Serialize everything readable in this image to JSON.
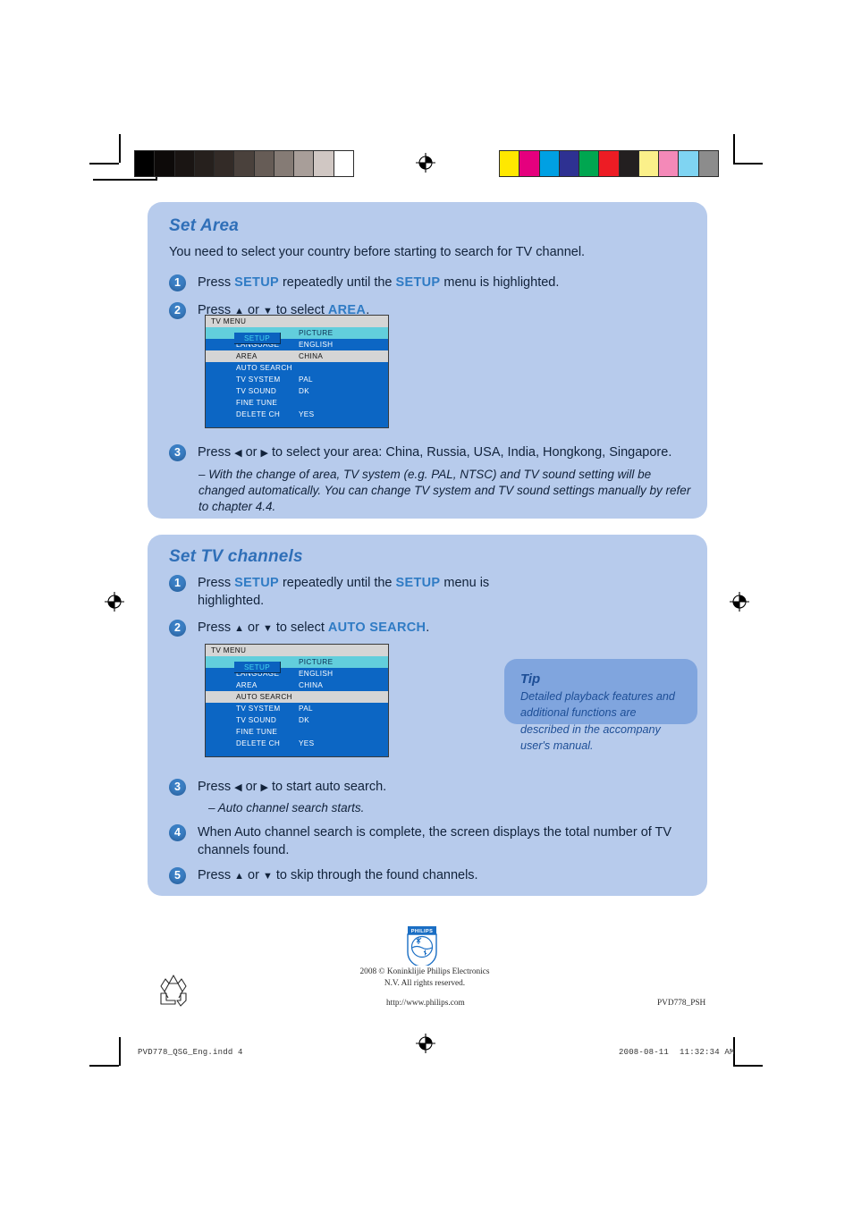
{
  "document": {
    "language": "English"
  },
  "colorbars": {
    "grayscale_label": "grayscale-calibration-bar",
    "grayscale": [
      "#000000",
      "#0d0a09",
      "#1a1513",
      "#26201d",
      "#332b27",
      "#4a413c",
      "#665c56",
      "#857b75",
      "#a89e99",
      "#d0c7c3",
      "#ffffff"
    ],
    "process_label": "process-color-calibration-bar",
    "process": [
      "#ffe800",
      "#e5007e",
      "#00a0e3",
      "#2e3192",
      "#00a650",
      "#ed1c24",
      "#231f20",
      "#fbf08a",
      "#f489b8",
      "#7fd4f2",
      "#8c8c8c"
    ]
  },
  "sections": [
    {
      "id": "set-area",
      "title": "Set Area",
      "intro": "You need to select your country before starting to search for TV channel.",
      "steps": [
        {
          "number": "1",
          "parts": [
            {
              "t": "Press ",
              "k": false
            },
            {
              "t": "SETUP",
              "k": true
            },
            {
              "t": " repeatedly until the ",
              "k": false
            },
            {
              "t": "SETUP",
              "k": true
            },
            {
              "t": " menu is highlighted.",
              "k": false
            }
          ]
        },
        {
          "number": "2",
          "parts": [
            {
              "t": "Press ",
              "k": false
            },
            {
              "t": "▲",
              "k": false
            },
            {
              "t": " or ",
              "k": false
            },
            {
              "t": "▼",
              "k": false
            },
            {
              "t": " to select ",
              "k": false
            },
            {
              "t": "AREA",
              "k": true
            },
            {
              "t": ".",
              "k": false
            }
          ]
        },
        {
          "number": "3",
          "parts": [
            {
              "t": "Press ",
              "k": false
            },
            {
              "t": "◀",
              "k": false
            },
            {
              "t": " or ",
              "k": false
            },
            {
              "t": "▶",
              "k": false
            },
            {
              "t": " to select your area: China, Russia, USA, India, Hongkong, Singapore.",
              "k": false
            }
          ],
          "note": "– With the change of area, TV system (e.g. PAL, NTSC) and TV sound setting will be changed automatically. You can change TV system and TV sound settings manually by refer to chapter 4.4."
        }
      ]
    },
    {
      "id": "set-tv-channels",
      "title": "Set TV channels",
      "steps": [
        {
          "number": "1",
          "parts": [
            {
              "t": "Press ",
              "k": false
            },
            {
              "t": "SETUP",
              "k": true
            },
            {
              "t": " repeatedly until the ",
              "k": false
            },
            {
              "t": "SETUP",
              "k": true
            },
            {
              "t": " menu is highlighted.",
              "k": false
            }
          ]
        },
        {
          "number": "2",
          "parts": [
            {
              "t": "Press ",
              "k": false
            },
            {
              "t": "▲",
              "k": false
            },
            {
              "t": " or ",
              "k": false
            },
            {
              "t": "▼",
              "k": false
            },
            {
              "t": " to select ",
              "k": false
            },
            {
              "t": "AUTO SEARCH",
              "k": true
            },
            {
              "t": ".",
              "k": false
            }
          ]
        },
        {
          "number": "3",
          "parts": [
            {
              "t": "Press ",
              "k": false
            },
            {
              "t": "◀",
              "k": false
            },
            {
              "t": " or ",
              "k": false
            },
            {
              "t": "▶",
              "k": false
            },
            {
              "t": " to start auto search.",
              "k": false
            }
          ],
          "note": "– Auto channel search starts."
        },
        {
          "number": "4",
          "parts": [
            {
              "t": "When Auto channel search is complete, the screen displays the total number of TV channels found.",
              "k": false
            }
          ]
        },
        {
          "number": "5",
          "parts": [
            {
              "t": "Press ",
              "k": false
            },
            {
              "t": "▲",
              "k": false
            },
            {
              "t": " or ",
              "k": false
            },
            {
              "t": "▼",
              "k": false
            },
            {
              "t": " to skip through the found channels.",
              "k": false
            }
          ]
        }
      ]
    }
  ],
  "tv_menu": {
    "header": "TV MENU",
    "setup_tab": "SETUP",
    "rows": [
      {
        "label": "SETUP",
        "value": "PICTURE",
        "style": "setup"
      },
      {
        "label": "LANGUAGE",
        "value": "ENGLISH",
        "style": "normal"
      },
      {
        "label": "AREA",
        "value": "CHINA",
        "style": "normal"
      },
      {
        "label": "AUTO SEARCH",
        "value": "",
        "style": "normal"
      },
      {
        "label": "TV SYSTEM",
        "value": "PAL",
        "style": "normal"
      },
      {
        "label": "TV SOUND",
        "value": "DK",
        "style": "normal"
      },
      {
        "label": "FINE TUNE",
        "value": "",
        "style": "normal"
      },
      {
        "label": "DELETE CH",
        "value": "YES",
        "style": "normal"
      }
    ],
    "highlighted_area": "AREA",
    "highlighted_auto_search": "AUTO SEARCH"
  },
  "tip": {
    "title": "Tip",
    "body": "Detailed playback features and additional functions are described in the accompany user's manual."
  },
  "footer": {
    "logo_text": "PHILIPS",
    "copyright_line1": "2008 © Koninklijie Philips Electronics",
    "copyright_line2": "N.V.  All rights reserved.",
    "url": "http://www.philips.com",
    "model_code": "PVD778_PSH",
    "print_filename": "PVD778_QSG_Eng.indd    4",
    "print_date": "2008-08-11",
    "print_time": "11:32:34 AM"
  }
}
